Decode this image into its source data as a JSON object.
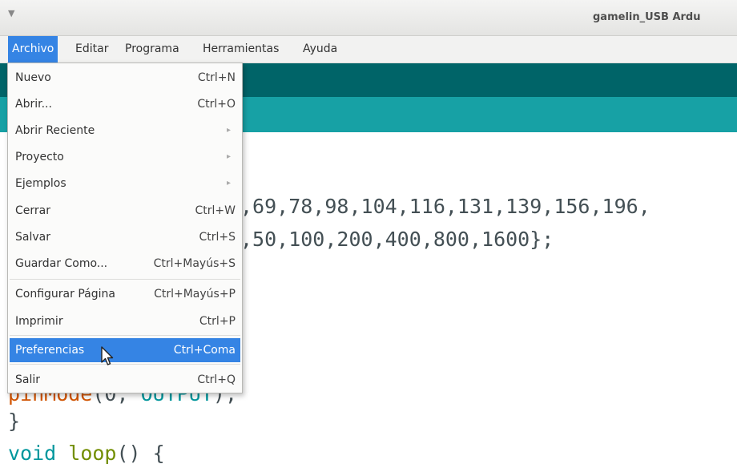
{
  "window": {
    "title": "gamelin_USB Ardu"
  },
  "menubar": {
    "items": [
      "Archivo",
      "Editar",
      "Programa",
      "Herramientas",
      "Ayuda"
    ]
  },
  "file_menu": {
    "nuevo": {
      "label": "Nuevo",
      "shortcut": "Ctrl+N"
    },
    "abrir": {
      "label": "Abrir...",
      "shortcut": "Ctrl+O"
    },
    "abrir_reciente": {
      "label": "Abrir Reciente",
      "submenu": "▸"
    },
    "proyecto": {
      "label": "Proyecto",
      "submenu": "▸"
    },
    "ejemplos": {
      "label": "Ejemplos",
      "submenu": "▸"
    },
    "cerrar": {
      "label": "Cerrar",
      "shortcut": "Ctrl+W"
    },
    "salvar": {
      "label": "Salvar",
      "shortcut": "Ctrl+S"
    },
    "guardar_como": {
      "label": "Guardar Como...",
      "shortcut": "Ctrl+Mayús+S"
    },
    "configurar_pagina": {
      "label": "Configurar Página",
      "shortcut": "Ctrl+Mayús+P"
    },
    "imprimir": {
      "label": "Imprimir",
      "shortcut": "Ctrl+P"
    },
    "preferencias": {
      "label": "Preferencias",
      "shortcut": "Ctrl+Coma"
    },
    "salir": {
      "label": "Salir",
      "shortcut": "Ctrl+Q"
    }
  },
  "editor": {
    "line1": ",69,78,98,104,116,131,139,156,196,",
    "line2": ",50,100,200,400,800,1600};",
    "pinmode_fn": "pinMode",
    "pinmode_args_open": "(0, ",
    "pinmode_const": "OUTPUT",
    "pinmode_close": ");",
    "brace_close": "}",
    "loop_type": "void",
    "loop_name": "loop",
    "loop_rest": "() {"
  },
  "colors": {
    "toolbar": "#006468",
    "tabbar": "#17a1a5",
    "menu_highlight": "#3584e4",
    "code_orange": "#d35400",
    "code_teal": "#00979d",
    "code_green": "#728e00"
  }
}
